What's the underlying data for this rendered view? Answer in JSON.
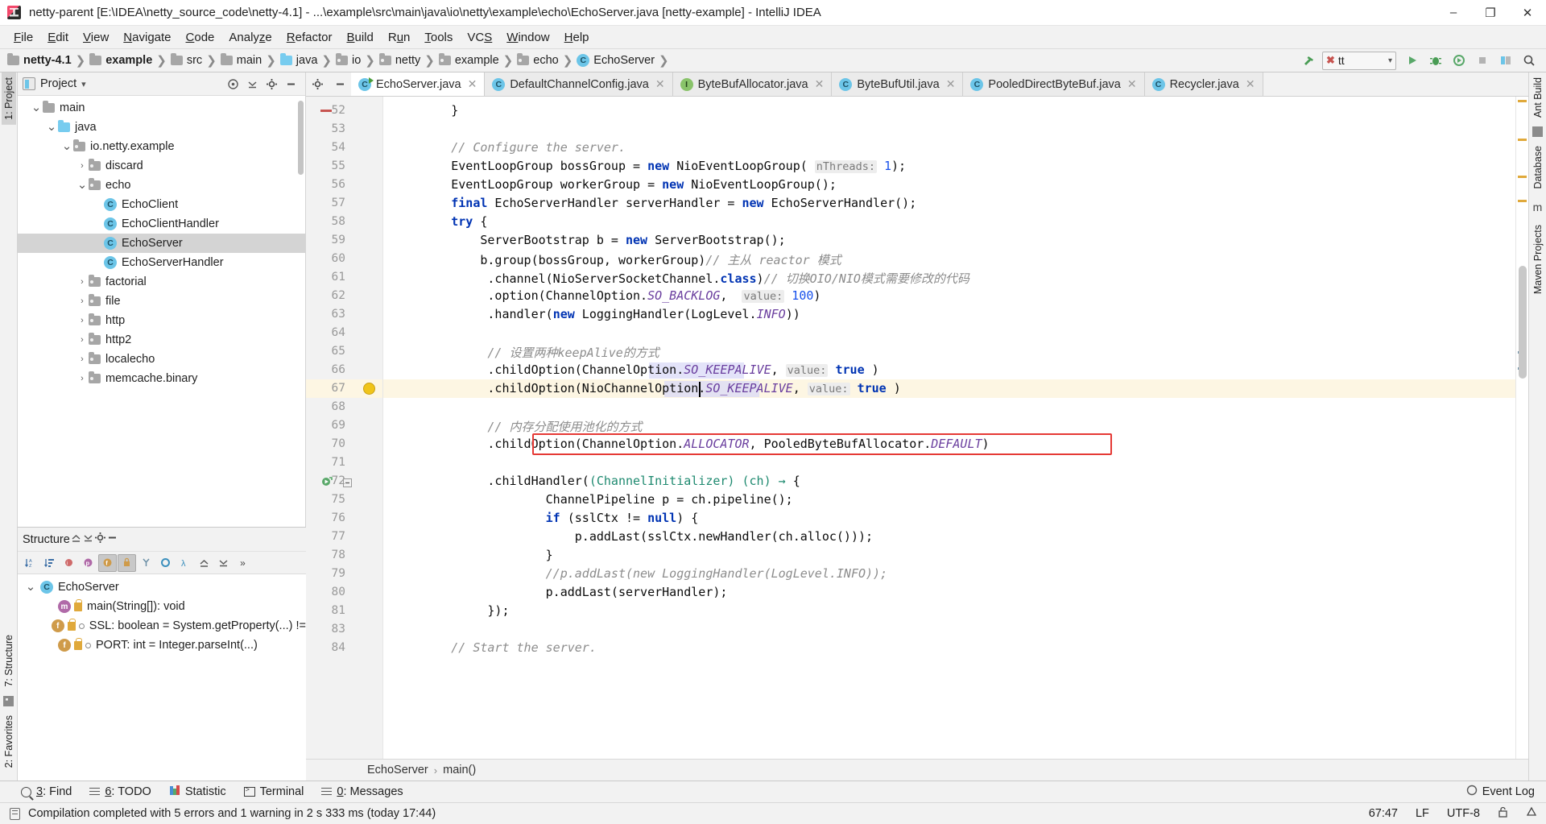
{
  "window": {
    "title": "netty-parent [E:\\IDEA\\netty_source_code\\netty-4.1] - ...\\example\\src\\main\\java\\io\\netty\\example\\echo\\EchoServer.java [netty-example] - IntelliJ IDEA",
    "minimize": "–",
    "maximize": "❐",
    "close": "✕"
  },
  "menubar": [
    {
      "label": "File"
    },
    {
      "label": "Edit"
    },
    {
      "label": "View"
    },
    {
      "label": "Navigate"
    },
    {
      "label": "Code"
    },
    {
      "label": "Analyze"
    },
    {
      "label": "Refactor"
    },
    {
      "label": "Build"
    },
    {
      "label": "Run"
    },
    {
      "label": "Tools"
    },
    {
      "label": "VCS"
    },
    {
      "label": "Window"
    },
    {
      "label": "Help"
    }
  ],
  "breadcrumb": [
    {
      "label": "netty-4.1",
      "icon": "folder-icon",
      "bold": true
    },
    {
      "label": "example",
      "icon": "folder-icon",
      "bold": true
    },
    {
      "label": "src",
      "icon": "folder-icon",
      "bold": false
    },
    {
      "label": "main",
      "icon": "folder-icon",
      "bold": false
    },
    {
      "label": "java",
      "icon": "source-folder-icon",
      "bold": false
    },
    {
      "label": "io",
      "icon": "package-icon",
      "bold": false
    },
    {
      "label": "netty",
      "icon": "package-icon",
      "bold": false
    },
    {
      "label": "example",
      "icon": "package-icon",
      "bold": false
    },
    {
      "label": "echo",
      "icon": "package-icon",
      "bold": false
    },
    {
      "label": "EchoServer",
      "icon": "class-icon",
      "bold": false
    }
  ],
  "toolbar": {
    "build_icon": "hammer-icon",
    "run_config": {
      "name": "tt",
      "error_mark": "✖",
      "chevron": "▾"
    },
    "run_label": "run-icon",
    "debug_label": "debug-icon",
    "coverage_label": "run-with-coverage-icon",
    "stop_label": "stop-icon",
    "layout_label": "layout-icon",
    "search_label": "search-icon"
  },
  "project_panel": {
    "title": "Project",
    "chevron": "▾",
    "header_icons": [
      "target-icon",
      "collapse-all-icon",
      "gear-icon",
      "hide-icon"
    ],
    "tree": [
      {
        "depth": 3,
        "chev": "⌄",
        "label": "main",
        "icon": "folder-icon",
        "selected": false
      },
      {
        "depth": 4,
        "chev": "⌄",
        "label": "java",
        "icon": "source-folder-icon",
        "selected": false
      },
      {
        "depth": 5,
        "chev": "⌄",
        "label": "io.netty.example",
        "icon": "package-icon",
        "selected": false
      },
      {
        "depth": 6,
        "chev": "›",
        "label": "discard",
        "icon": "package-icon",
        "selected": false
      },
      {
        "depth": 6,
        "chev": "⌄",
        "label": "echo",
        "icon": "package-icon",
        "selected": false
      },
      {
        "depth": 7,
        "chev": "",
        "label": "EchoClient",
        "icon": "runnable-class-icon",
        "selected": false
      },
      {
        "depth": 7,
        "chev": "",
        "label": "EchoClientHandler",
        "icon": "class-icon",
        "selected": false
      },
      {
        "depth": 7,
        "chev": "",
        "label": "EchoServer",
        "icon": "runnable-class-icon",
        "selected": true
      },
      {
        "depth": 7,
        "chev": "",
        "label": "EchoServerHandler",
        "icon": "class-icon",
        "selected": false
      },
      {
        "depth": 6,
        "chev": "›",
        "label": "factorial",
        "icon": "package-icon",
        "selected": false
      },
      {
        "depth": 6,
        "chev": "›",
        "label": "file",
        "icon": "package-icon",
        "selected": false
      },
      {
        "depth": 6,
        "chev": "›",
        "label": "http",
        "icon": "package-icon",
        "selected": false
      },
      {
        "depth": 6,
        "chev": "›",
        "label": "http2",
        "icon": "package-icon",
        "selected": false
      },
      {
        "depth": 6,
        "chev": "›",
        "label": "localecho",
        "icon": "package-icon",
        "selected": false
      },
      {
        "depth": 6,
        "chev": "›",
        "label": "memcache.binary",
        "icon": "package-icon",
        "selected": false
      }
    ]
  },
  "structure_panel": {
    "title": "Structure",
    "toolbar_icons": [
      "sort-alpha-icon",
      "sort-by-type-icon",
      "show-inherited-icon",
      "show-properties-icon",
      "show-fields-icon",
      "show-non-public-icon",
      "group-icon",
      "show-anonymous-icon",
      "lambda-icon",
      "expand-all-icon",
      "collapse-all-icon",
      "more-icon"
    ],
    "rows": [
      {
        "depth": 0,
        "chev": "⌄",
        "label": "EchoServer",
        "icon": "class-icon"
      },
      {
        "depth": 1,
        "chev": "",
        "label": "main(String[]): void",
        "icon": "method-icon"
      },
      {
        "depth": 1,
        "chev": "",
        "label": "SSL: boolean = System.getProperty(...) !=",
        "icon": "field-icon"
      },
      {
        "depth": 1,
        "chev": "",
        "label": "PORT: int = Integer.parseInt(...)",
        "icon": "field-icon"
      }
    ]
  },
  "editor_tabs": [
    {
      "label": "EchoServer.java",
      "icon": "runnable-class-icon",
      "active": true,
      "close": "✕"
    },
    {
      "label": "DefaultChannelConfig.java",
      "icon": "class-icon",
      "active": false,
      "close": "✕"
    },
    {
      "label": "ByteBufAllocator.java",
      "icon": "interface-icon",
      "active": false,
      "close": "✕"
    },
    {
      "label": "ByteBufUtil.java",
      "icon": "class-icon",
      "active": false,
      "close": "✕"
    },
    {
      "label": "PooledDirectByteBuf.java",
      "icon": "class-icon",
      "active": false,
      "close": "✕"
    },
    {
      "label": "Recycler.java",
      "icon": "class-icon",
      "active": false,
      "close": "✕"
    }
  ],
  "editor": {
    "first_line": 52,
    "line_numbers": [
      52,
      53,
      54,
      55,
      56,
      57,
      58,
      59,
      60,
      61,
      62,
      63,
      64,
      65,
      66,
      67,
      68,
      69,
      70,
      71,
      72,
      75,
      76,
      77,
      78,
      79,
      80,
      81,
      83,
      84
    ],
    "highlighted_line_number": 67,
    "lines": [
      "        }",
      "",
      "        // Configure the server.",
      "        EventLoopGroup bossGroup = new NioEventLoopGroup( nThreads: 1);",
      "        EventLoopGroup workerGroup = new NioEventLoopGroup();",
      "        final EchoServerHandler serverHandler = new EchoServerHandler();",
      "        try {",
      "            ServerBootstrap b = new ServerBootstrap();",
      "            b.group(bossGroup, workerGroup)// 主从 reactor 模式",
      "             .channel(NioServerSocketChannel.class)// 切换OIO/NIO模式需要修改的代码",
      "             .option(ChannelOption.SO_BACKLOG,  value: 100)",
      "             .handler(new LoggingHandler(LogLevel.INFO))",
      "",
      "             // 设置两种keepAlive的方式",
      "             .childOption(ChannelOption.SO_KEEPALIVE, value: true )",
      "             .childOption(NioChannelOption.SO_KEEPALIVE, value: true )",
      "",
      "             // 内存分配使用池化的方式",
      "             .childOption(ChannelOption.ALLOCATOR, PooledByteBufAllocator.DEFAULT)",
      "",
      "             .childHandler((ChannelInitializer) (ch) → {",
      "                     ChannelPipeline p = ch.pipeline();",
      "                     if (sslCtx != null) {",
      "                         p.addLast(sslCtx.newHandler(ch.alloc()));",
      "                     }",
      "                     //p.addLast(new LoggingHandler(LogLevel.INFO));",
      "                     p.addLast(serverHandler);",
      "             });",
      "",
      "        // Start the server."
    ],
    "annotation_box_line": 70,
    "bulb_icon": "intention-bulb-icon",
    "run_gutter_icon": "run-method-gutter-icon"
  },
  "editor_breadcrumb": {
    "items": [
      "EchoServer",
      "main()"
    ],
    "separator": "›"
  },
  "left_stripe": {
    "tabs": [
      "1: Project",
      "7: Structure",
      "2: Favorites"
    ]
  },
  "right_stripe": {
    "tabs": [
      "Ant Build",
      "Database",
      "Maven Projects"
    ]
  },
  "bottom_toolbar": [
    {
      "num": "3",
      "label": ": Find",
      "icon": "search-icon"
    },
    {
      "num": "6",
      "label": ": TODO",
      "icon": "todo-icon"
    },
    {
      "num": "",
      "label": "Statistic",
      "icon": "statistic-icon"
    },
    {
      "num": "",
      "label": "Terminal",
      "icon": "terminal-icon"
    },
    {
      "num": "0",
      "label": ": Messages",
      "icon": "messages-icon"
    }
  ],
  "event_log": {
    "label": "Event Log",
    "icon": "event-log-icon"
  },
  "statusbar": {
    "message": "Compilation completed with 5 errors and 1 warning in 2 s 333 ms (today 17:44)",
    "message_icon": "document-icon",
    "caret_position": "67:47",
    "line_separator": "LF",
    "encoding": "UTF-8",
    "lock_icon": "unlocked-icon",
    "inspector_icon": "inspector-icon"
  },
  "colors": {
    "accent_blue": "#6cc5e8",
    "keyword": "#0033b3",
    "comment": "#8c8c8c",
    "static_field": "#6a3e9e",
    "number": "#1750eb",
    "annotation_box": "#e53935",
    "highlight_line": "#fdf6e3",
    "selection": "#d9d9f7"
  }
}
